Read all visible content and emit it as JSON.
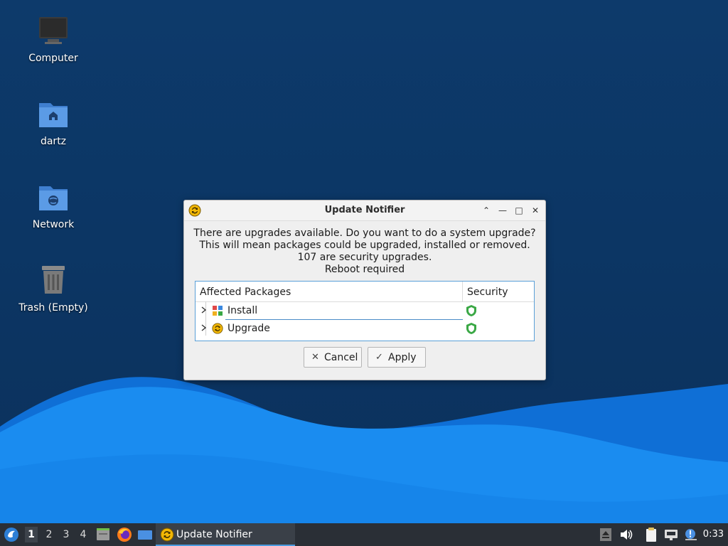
{
  "desktop": {
    "icons": [
      {
        "label": "Computer",
        "icon": "computer-icon"
      },
      {
        "label": "dartz",
        "icon": "home-folder-icon"
      },
      {
        "label": "Network",
        "icon": "network-folder-icon"
      },
      {
        "label": "Trash (Empty)",
        "icon": "trash-icon"
      }
    ]
  },
  "dialog": {
    "title": "Update Notifier",
    "message_lines": [
      "There are upgrades available. Do you want to do a system upgrade?",
      "This will mean packages could be upgraded, installed or removed.",
      "107 are security upgrades.",
      "Reboot required"
    ],
    "columns": [
      "Affected Packages",
      "Security"
    ],
    "rows": [
      {
        "label": "Install",
        "icon": "install-package-icon",
        "security_icon": "shield-icon"
      },
      {
        "label": "Upgrade",
        "icon": "upgrade-package-icon",
        "security_icon": "shield-icon"
      }
    ],
    "buttons": {
      "cancel": "Cancel",
      "apply": "Apply"
    },
    "window_controls": [
      "keep-above",
      "minimize",
      "maximize",
      "close"
    ]
  },
  "taskbar": {
    "workspaces": [
      "1",
      "2",
      "3",
      "4"
    ],
    "active_workspace": "1",
    "task_label": "Update Notifier",
    "clock": "0:33"
  },
  "colors": {
    "desktop_bg": "#0d3a6b",
    "wave_light": "#1a8cf0",
    "wave_mid": "#0f6fd6",
    "accent": "#4a9be0",
    "shield": "#3aa845"
  }
}
